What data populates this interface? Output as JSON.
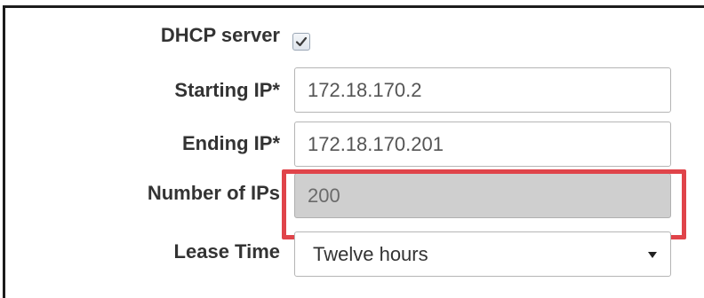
{
  "dhcp_server": {
    "label": "DHCP server",
    "checked": true
  },
  "starting_ip": {
    "label": "Starting IP*",
    "value": "172.18.170.2"
  },
  "ending_ip": {
    "label": "Ending IP*",
    "value": "172.18.170.201"
  },
  "number_of_ips": {
    "label": "Number of IPs",
    "value": "200"
  },
  "lease_time": {
    "label": "Lease Time",
    "selected": "Twelve hours"
  },
  "colors": {
    "highlight": "#e0444a",
    "disabled_field": "#cfcfcf"
  },
  "icons": {
    "checkbox": "checkmark-icon",
    "dropdown": "caret-down-icon"
  }
}
